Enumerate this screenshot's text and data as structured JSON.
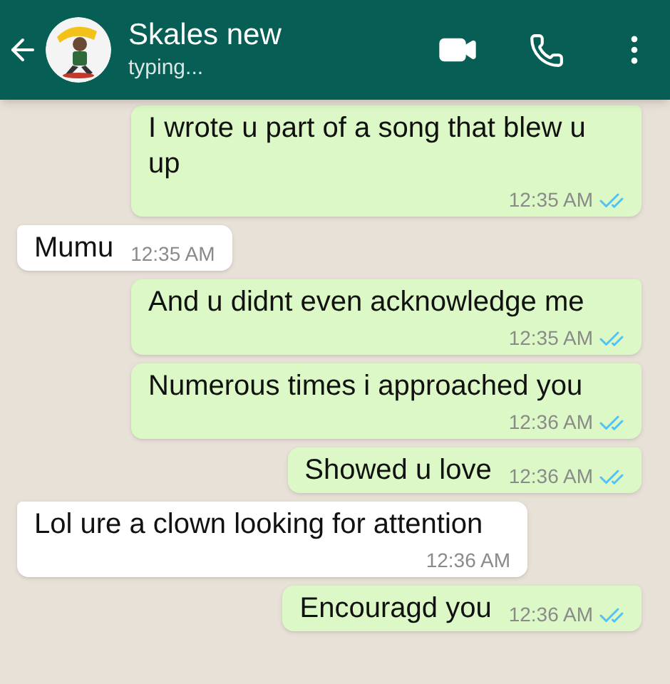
{
  "header": {
    "title": "Skales new",
    "status": "typing..."
  },
  "messages": [
    {
      "kind": "out",
      "text": "I wrote u part of a song that blew u up",
      "time": "12:35 AM",
      "read": true
    },
    {
      "kind": "in",
      "text": "Mumu",
      "time": "12:35 AM"
    },
    {
      "kind": "out",
      "text": "And u didnt even acknowledge me",
      "time": "12:35 AM",
      "read": true
    },
    {
      "kind": "out",
      "text": "Numerous times i approached you",
      "time": "12:36 AM",
      "read": true
    },
    {
      "kind": "out",
      "text": "Showed u love",
      "time": "12:36 AM",
      "read": true
    },
    {
      "kind": "in",
      "text": "Lol ure a clown looking for attention",
      "time": "12:36 AM"
    },
    {
      "kind": "out",
      "text": "Encouragd you",
      "time": "12:36 AM",
      "read": true
    }
  ]
}
